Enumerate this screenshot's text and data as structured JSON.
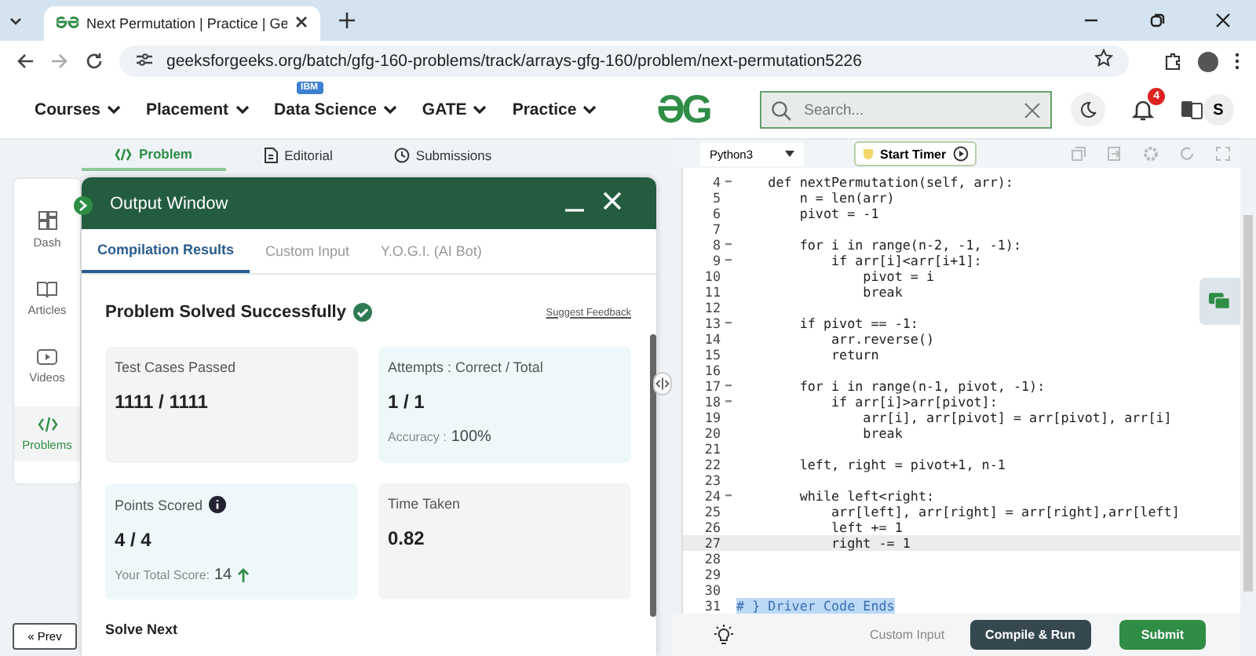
{
  "browser": {
    "tab_title": "Next Permutation | Practice | Ge",
    "url": "geeksforgeeks.org/batch/gfg-160-problems/track/arrays-gfg-160/problem/next-permutation5226"
  },
  "nav": {
    "items": [
      {
        "label": "Courses"
      },
      {
        "label": "Placement"
      },
      {
        "label": "Data Science",
        "badge": "IBM"
      },
      {
        "label": "GATE"
      },
      {
        "label": "Practice"
      }
    ],
    "logo": "ƏG",
    "search": {
      "placeholder": "Search..."
    },
    "notifications": "4",
    "avatar": "S"
  },
  "problem_tabs": [
    {
      "label": "Problem",
      "selected": true
    },
    {
      "label": "Editorial",
      "selected": false
    },
    {
      "label": "Submissions",
      "selected": false
    }
  ],
  "sidebar": {
    "items": [
      {
        "label": "Dash",
        "selected": false
      },
      {
        "label": "Articles",
        "selected": false
      },
      {
        "label": "Videos",
        "selected": false
      },
      {
        "label": "Problems",
        "selected": true
      }
    ],
    "prev": "« Prev"
  },
  "output": {
    "title": "Output Window",
    "tabs": [
      {
        "label": "Compilation Results",
        "selected": true
      },
      {
        "label": "Custom Input",
        "selected": false
      },
      {
        "label": "Y.O.G.I. (AI Bot)",
        "selected": false
      }
    ],
    "status": "Problem Solved Successfully",
    "feedback": "Suggest Feedback",
    "cards": [
      {
        "label": "Test Cases Passed",
        "value": "1111 / 1111",
        "color": "#f3f5f5"
      },
      {
        "label": "Attempts : Correct / Total",
        "value": "1 / 1",
        "note_label": "Accuracy :",
        "note_value": "100%",
        "color": "#eef8fb"
      },
      {
        "label": "Points Scored",
        "value": "4 / 4",
        "note_label": "Your Total Score:",
        "note_value": "14",
        "color": "#eef8fb"
      },
      {
        "label": "Time Taken",
        "value": "0.82",
        "color": "#f3f5f5"
      }
    ],
    "solve_next": "Solve Next"
  },
  "editor": {
    "language": "Python3",
    "timer": "Start Timer",
    "lines": [
      {
        "num": "4",
        "fold": true,
        "text": "    def nextPermutation(self, arr):",
        "active": false,
        "selected": false
      },
      {
        "num": "5",
        "fold": false,
        "text": "        n = len(arr)",
        "active": false,
        "selected": false
      },
      {
        "num": "6",
        "fold": false,
        "text": "        pivot = -1",
        "active": false,
        "selected": false
      },
      {
        "num": "7",
        "fold": false,
        "active": false,
        "selected": false
      },
      {
        "num": "8",
        "fold": true,
        "text": "        for i in range(n-2, -1, -1):",
        "active": false,
        "selected": false
      },
      {
        "num": "9",
        "fold": true,
        "text": "            if arr[i]<arr[i+1]:",
        "active": false,
        "selected": false
      },
      {
        "num": "10",
        "fold": false,
        "text": "                pivot = i",
        "active": false,
        "selected": false
      },
      {
        "num": "11",
        "fold": false,
        "text": "                break",
        "active": false,
        "selected": false
      },
      {
        "num": "12",
        "fold": false,
        "active": false,
        "selected": false
      },
      {
        "num": "13",
        "fold": true,
        "text": "        if pivot == -1:",
        "active": false,
        "selected": false
      },
      {
        "num": "14",
        "fold": false,
        "text": "            arr.reverse()",
        "active": false,
        "selected": false
      },
      {
        "num": "15",
        "fold": false,
        "text": "            return",
        "active": false,
        "selected": false
      },
      {
        "num": "16",
        "fold": false,
        "active": false,
        "selected": false
      },
      {
        "num": "17",
        "fold": true,
        "text": "        for i in range(n-1, pivot, -1):",
        "active": false,
        "selected": false
      },
      {
        "num": "18",
        "fold": true,
        "text": "            if arr[i]>arr[pivot]:",
        "active": false,
        "selected": false
      },
      {
        "num": "19",
        "fold": false,
        "text": "                arr[i], arr[pivot] = arr[pivot], arr[i]",
        "active": false,
        "selected": false
      },
      {
        "num": "20",
        "fold": false,
        "text": "                break",
        "active": false,
        "selected": false
      },
      {
        "num": "21",
        "fold": false,
        "active": false,
        "selected": false
      },
      {
        "num": "22",
        "fold": false,
        "text": "        left, right = pivot+1, n-1",
        "active": false,
        "selected": false
      },
      {
        "num": "23",
        "fold": false,
        "active": false,
        "selected": false
      },
      {
        "num": "24",
        "fold": true,
        "text": "        while left<right:",
        "active": false,
        "selected": false
      },
      {
        "num": "25",
        "fold": false,
        "text": "            arr[left], arr[right] = arr[right],arr[left]",
        "active": false,
        "selected": false
      },
      {
        "num": "26",
        "fold": false,
        "text": "            left += 1",
        "active": false,
        "selected": false
      },
      {
        "num": "27",
        "fold": false,
        "text": "            right -= 1",
        "active": true,
        "selected": false
      },
      {
        "num": "28",
        "fold": false,
        "active": false,
        "selected": false
      },
      {
        "num": "29",
        "fold": false,
        "active": false,
        "selected": false
      },
      {
        "num": "30",
        "fold": false,
        "active": false,
        "selected": false
      },
      {
        "num": "31",
        "fold": false,
        "text": "# } Driver Code Ends",
        "active": false,
        "selected": true
      }
    ],
    "custom_input": "Custom Input",
    "compile": "Compile & Run",
    "submit": "Submit"
  }
}
